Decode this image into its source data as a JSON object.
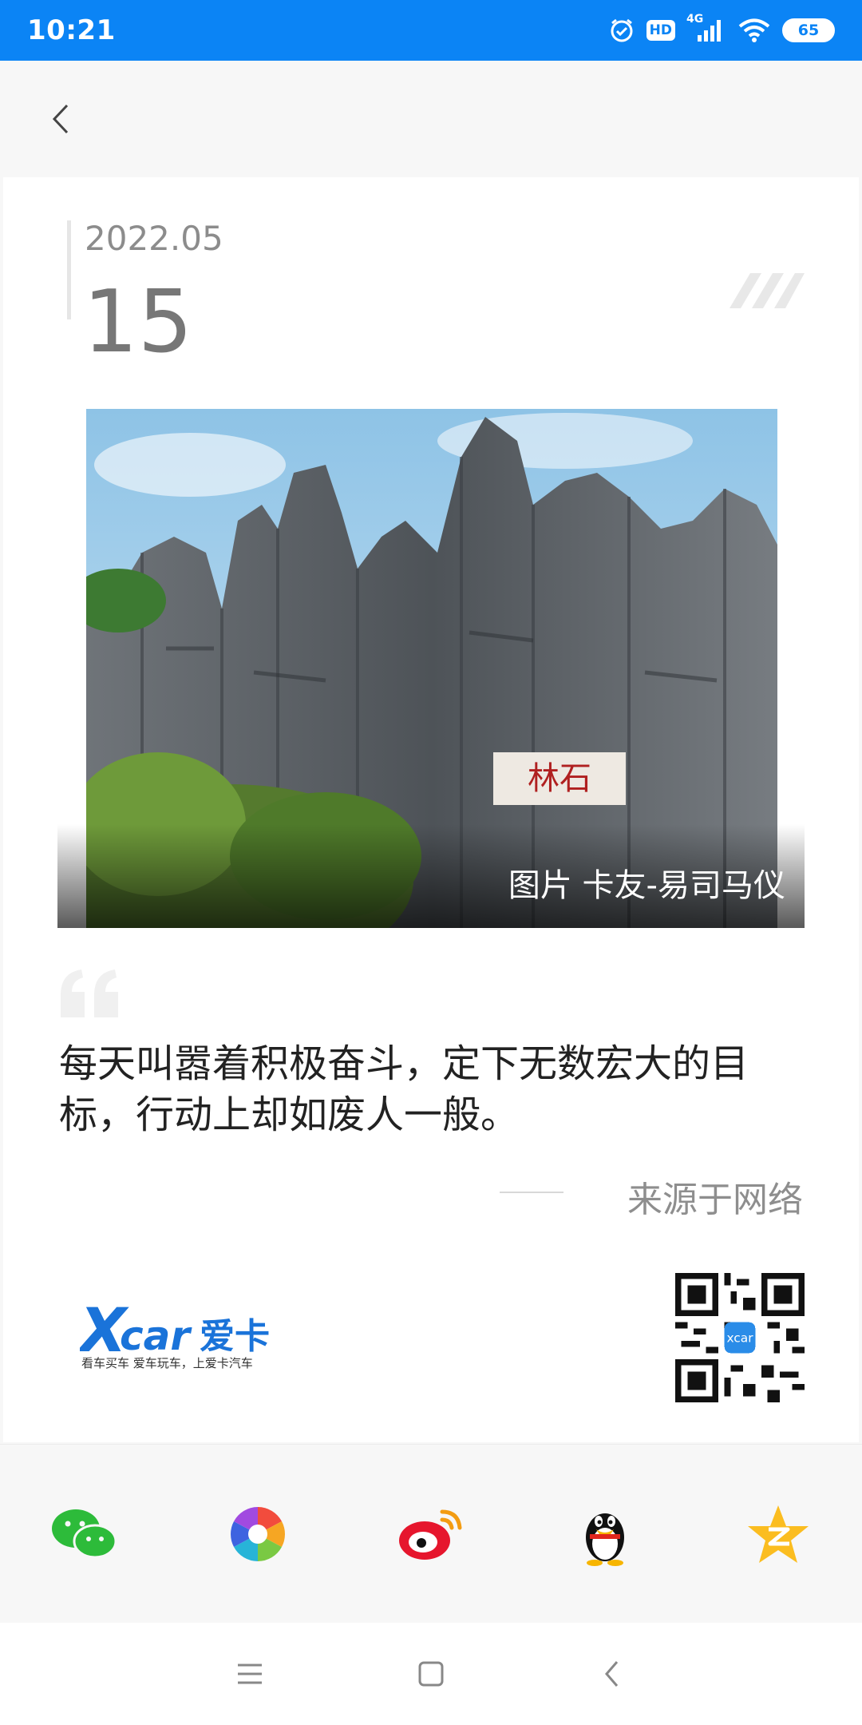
{
  "status_bar": {
    "time": "10:21",
    "hd": "HD",
    "network": "4G",
    "battery": "65",
    "icons": [
      "alarm-icon",
      "hd-icon",
      "signal-icon",
      "wifi-icon",
      "battery-icon"
    ]
  },
  "header": {
    "back_icon": "back-arrow-icon"
  },
  "card": {
    "date_year_month": "2022.05",
    "date_day": "15",
    "photo_caption": "图片 卡友-易司马仪",
    "quote": "每天叫嚣着积极奋斗，定下无数宏大的目标，行动上却如废人一般。",
    "source": "来源于网络",
    "logo_text": "Xcar爱卡",
    "logo_tagline": "看车买车 爱车玩车，上爱卡汽车",
    "qr_badge": "xcar"
  },
  "share_bar": {
    "items": [
      "wechat-icon",
      "moments-icon",
      "weibo-icon",
      "qq-icon",
      "qzone-icon"
    ]
  },
  "nav_bar": {
    "items": [
      "menu-icon",
      "home-icon",
      "back-icon"
    ]
  },
  "colors": {
    "status_bar": "#0b84f5",
    "text_dark": "#222222",
    "text_gray": "#8c8c8c"
  }
}
